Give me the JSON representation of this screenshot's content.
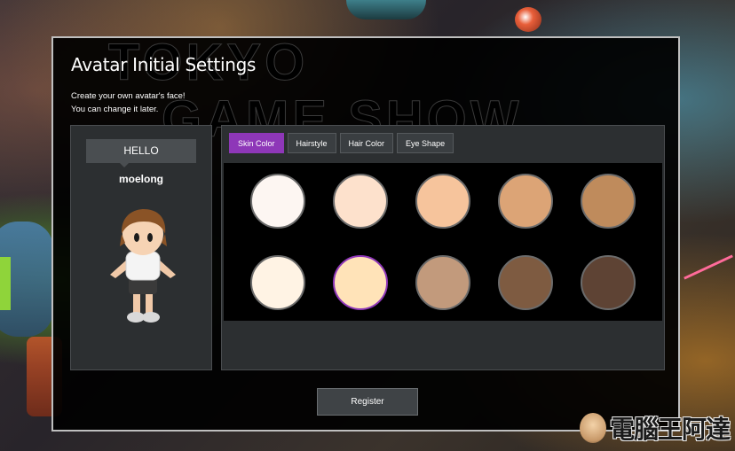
{
  "background": {
    "watermark_lines": [
      "TOKYO",
      "GAME SHOW"
    ],
    "site_watermark_text": "電腦王阿達"
  },
  "dialog": {
    "title": "Avatar Initial Settings",
    "subtitle_lines": [
      "Create your own avatar's face!",
      "You can change it later."
    ]
  },
  "profile": {
    "greeting": "HELLO",
    "username": "moelong"
  },
  "tabs": [
    {
      "label": "Skin Color",
      "active": true
    },
    {
      "label": "Hairstyle",
      "active": false
    },
    {
      "label": "Hair Color",
      "active": false
    },
    {
      "label": "Eye Shape",
      "active": false
    }
  ],
  "swatches": [
    {
      "color": "#fdf6f2",
      "selected": false
    },
    {
      "color": "#fde1cc",
      "selected": false
    },
    {
      "color": "#f6c49c",
      "selected": false
    },
    {
      "color": "#dca476",
      "selected": false
    },
    {
      "color": "#bf8b5c",
      "selected": false
    },
    {
      "color": "#fff3e4",
      "selected": false
    },
    {
      "color": "#ffe3b8",
      "selected": true
    },
    {
      "color": "#c29a7c",
      "selected": false
    },
    {
      "color": "#7e5b41",
      "selected": false
    },
    {
      "color": "#5e4334",
      "selected": false
    }
  ],
  "actions": {
    "register_label": "Register"
  },
  "colors": {
    "accent": "#8e37b8",
    "panel": "#2c2f31",
    "dialog_bg": "#000000"
  }
}
